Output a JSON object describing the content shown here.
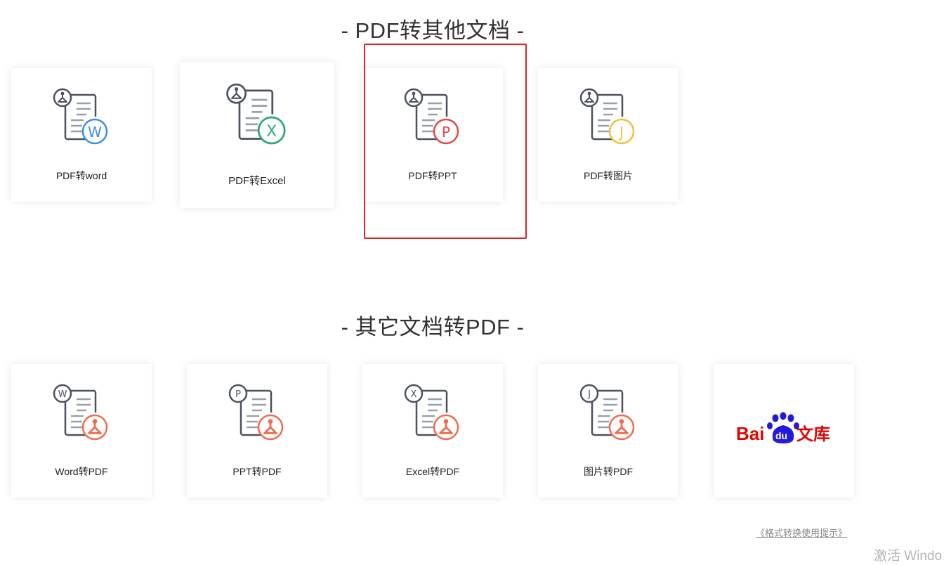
{
  "sections": {
    "pdf_to_other": {
      "title": "- PDF转其他文档 -",
      "cards": [
        {
          "label": "PDF转word",
          "badge": "W",
          "badge_color": "#3a8ee6",
          "icon": "pdf-to-word-icon"
        },
        {
          "label": "PDF转Excel",
          "badge": "X",
          "badge_color": "#2aa876",
          "icon": "pdf-to-excel-icon"
        },
        {
          "label": "PDF转PPT",
          "badge": "P",
          "badge_color": "#e64545",
          "icon": "pdf-to-ppt-icon"
        },
        {
          "label": "PDF转图片",
          "badge": "J",
          "badge_color": "#f4bd3c",
          "icon": "pdf-to-image-icon"
        }
      ]
    },
    "other_to_pdf": {
      "title": "- 其它文档转PDF -",
      "cards": [
        {
          "label": "Word转PDF",
          "corner": "W",
          "icon": "word-to-pdf-icon"
        },
        {
          "label": "PPT转PDF",
          "corner": "P",
          "icon": "ppt-to-pdf-icon"
        },
        {
          "label": "Excel转PDF",
          "corner": "X",
          "icon": "excel-to-pdf-icon"
        },
        {
          "label": "图片转PDF",
          "corner": "J",
          "icon": "image-to-pdf-icon"
        }
      ]
    }
  },
  "baidu": {
    "text_bai": "Bai",
    "text_du": "du",
    "text_wenku": "文库",
    "red": "#e10601",
    "blue": "#2319dc"
  },
  "pdf_badge_color": "#f06b4d",
  "doc_color": "#4d5160",
  "line_color": "#9aa0ab",
  "highlight_color": "#e02020",
  "footer": {
    "tip_link": "《格式转换使用提示》",
    "watermark": "激活 Windo"
  }
}
